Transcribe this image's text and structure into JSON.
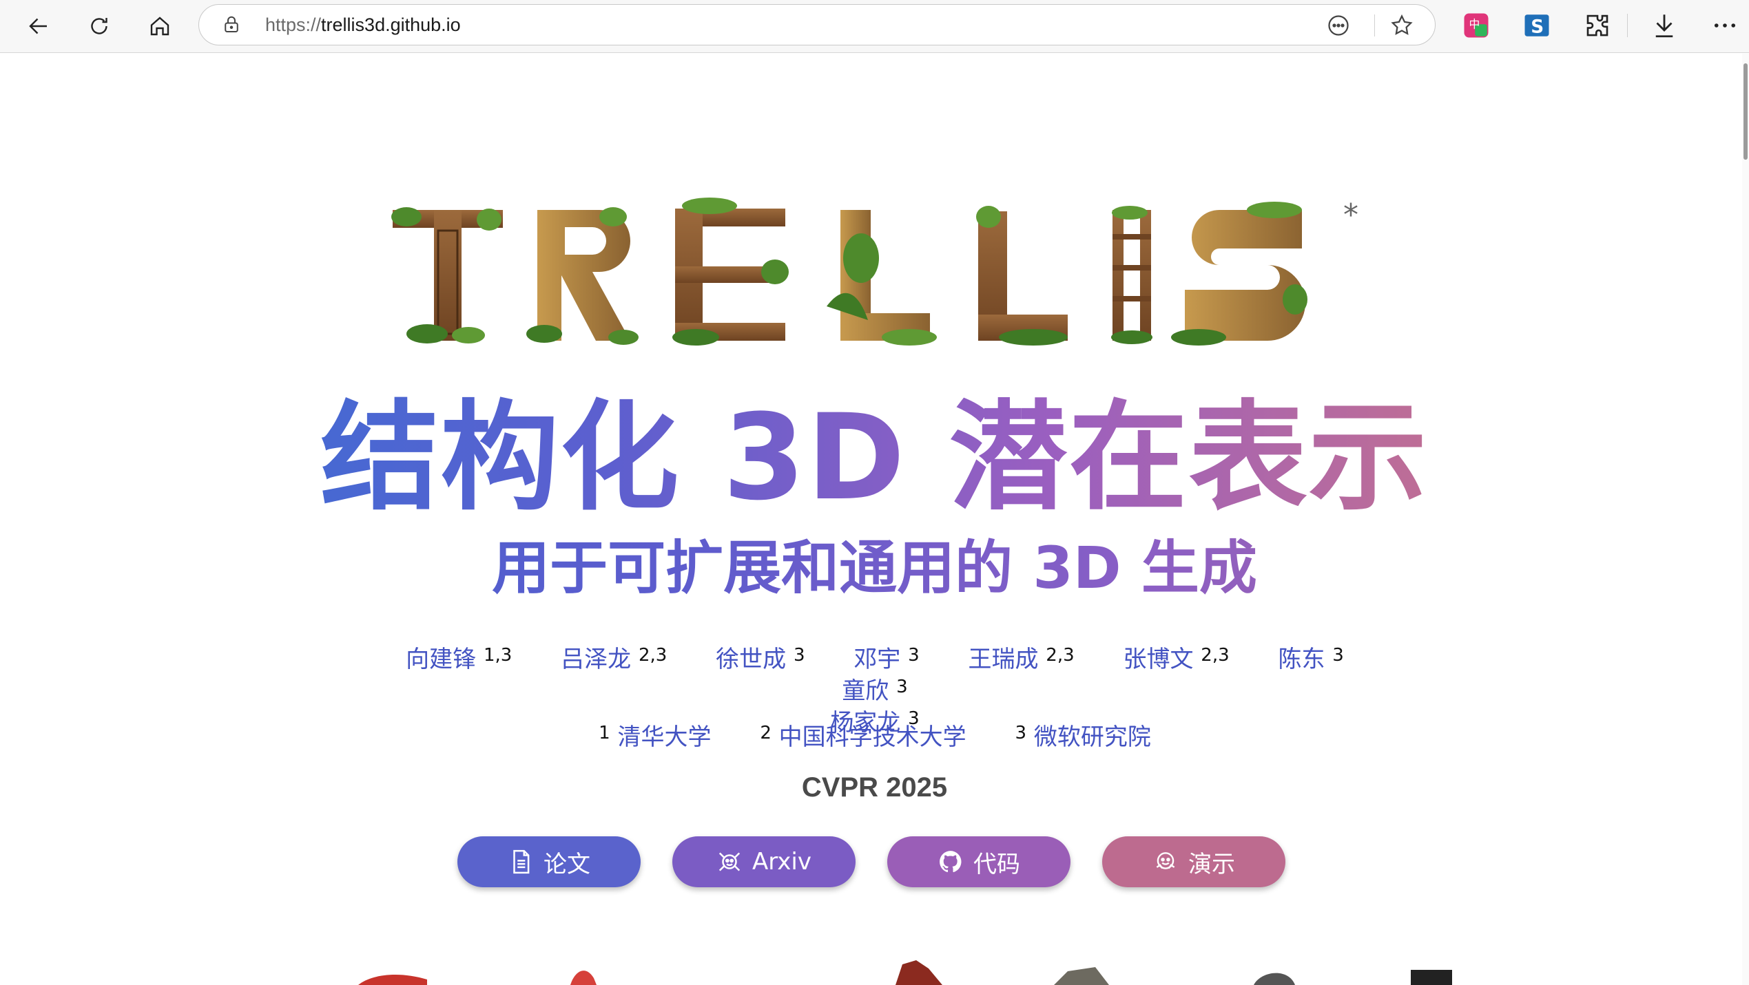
{
  "browser": {
    "url_scheme": "https://",
    "url_host": "trellis3d.github.io",
    "icons": [
      "back-arrow-icon",
      "refresh-icon",
      "home-icon",
      "lock-icon",
      "more-icon",
      "favorite-star-icon",
      "translate-extension-icon",
      "s-extension-icon",
      "extensions-puzzle-icon",
      "download-icon",
      "menu-ellipsis-icon"
    ]
  },
  "page": {
    "logo_word": "TRELLIS",
    "logo_mark": "*",
    "hero_title": "结构化 3D 潜在表示",
    "hero_subtitle": "用于可扩展和通用的 3D 生成",
    "authors": [
      {
        "name": "向建锋",
        "sup": "1,3"
      },
      {
        "name": "吕泽龙",
        "sup": "2,3"
      },
      {
        "name": "徐世成",
        "sup": "3"
      },
      {
        "name": "邓宇",
        "sup": "3"
      },
      {
        "name": "王瑞成",
        "sup": "2,3"
      },
      {
        "name": "张博文",
        "sup": "2,3"
      },
      {
        "name": "陈东",
        "sup": "3"
      },
      {
        "name": "童欣",
        "sup": "3"
      },
      {
        "name": "杨家龙",
        "sup": "3"
      }
    ],
    "affiliations": [
      {
        "sup": "1",
        "name": "清华大学"
      },
      {
        "sup": "2",
        "name": "中国科学技术大学"
      },
      {
        "sup": "3",
        "name": "微软研究院"
      }
    ],
    "venue": "CVPR 2025",
    "buttons": [
      {
        "label": "论文",
        "icon": "document-icon"
      },
      {
        "label": "Arxiv",
        "icon": "arxiv-icon"
      },
      {
        "label": "代码",
        "icon": "github-icon"
      },
      {
        "label": "演示",
        "icon": "huggingface-icon"
      }
    ]
  },
  "colors": {
    "author_link": "#4353c2",
    "btn_paper": "#5a63cc",
    "btn_arxiv": "#7b5cc4",
    "btn_code": "#9a5eb7",
    "btn_demo": "#bd6b8f"
  }
}
